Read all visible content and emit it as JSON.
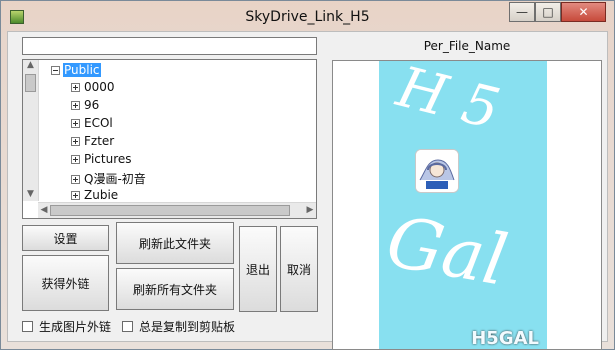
{
  "window": {
    "title": "SkyDrive_Link_H5",
    "controls": {
      "minimize": "—",
      "maximize": "□",
      "close": "✕"
    }
  },
  "path": {
    "value": ""
  },
  "tree": {
    "root": "Public",
    "children": [
      "0000",
      "96",
      "ECOl",
      "Fzter",
      "Pictures",
      "Q漫画-初音",
      "Zubie"
    ]
  },
  "buttons": {
    "settings": "设置",
    "get_link": "获得外链",
    "refresh_folder": "刷新此文件夹",
    "refresh_all": "刷新所有文件夹",
    "exit": "退出",
    "cancel": "取消"
  },
  "checkboxes": {
    "image_link": "生成图片外链",
    "copy_clipboard": "总是复制到剪贴板"
  },
  "preview": {
    "title": "Per_File_Name",
    "watermark_top": "H 5",
    "watermark_bottom": "Gal",
    "brand": "H5GAL"
  }
}
